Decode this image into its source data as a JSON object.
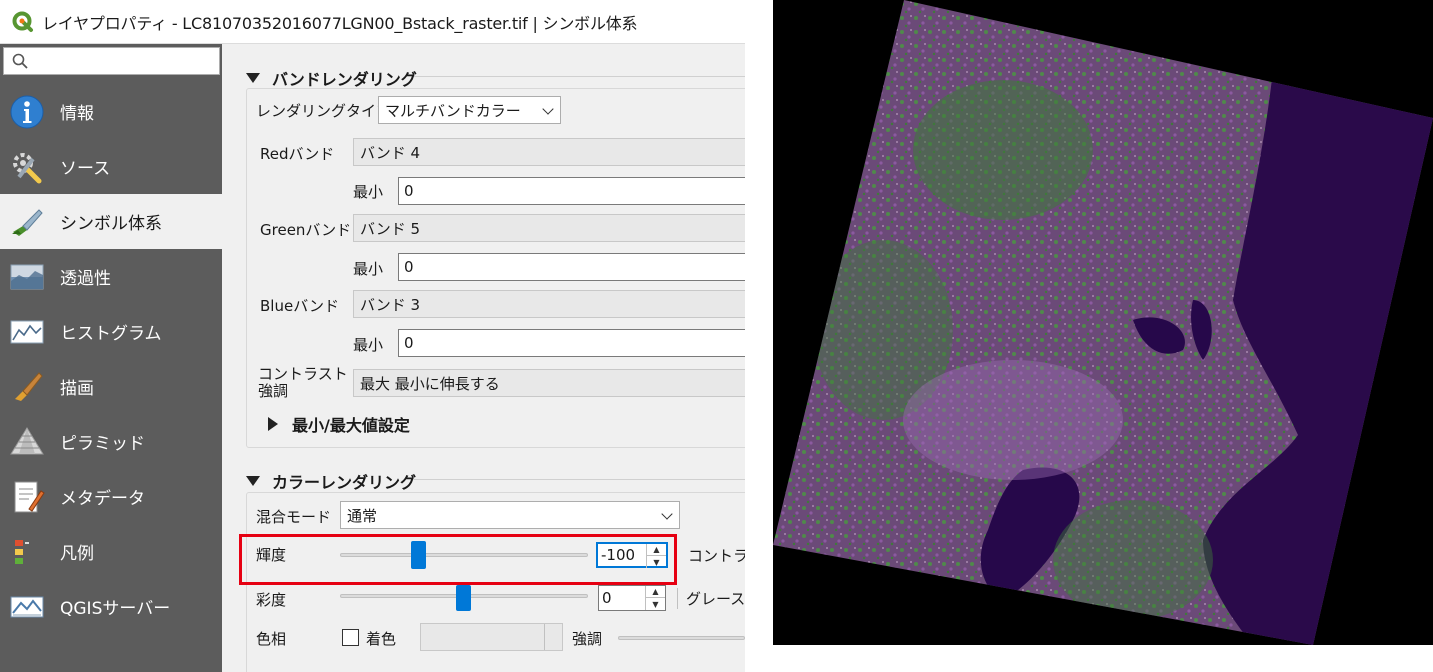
{
  "window": {
    "title": "レイヤプロパティ - LC81070352016077LGN00_Bstack_raster.tif | シンボル体系"
  },
  "sidebar": {
    "search_placeholder": "",
    "items": [
      {
        "label": "情報",
        "icon": "info-icon"
      },
      {
        "label": "ソース",
        "icon": "source-wrench-icon"
      },
      {
        "label": "シンボル体系",
        "icon": "symbology-brush-icon",
        "active": true
      },
      {
        "label": "透過性",
        "icon": "transparency-icon"
      },
      {
        "label": "ヒストグラム",
        "icon": "histogram-icon"
      },
      {
        "label": "描画",
        "icon": "rendering-brush-icon"
      },
      {
        "label": "ピラミッド",
        "icon": "pyramid-icon"
      },
      {
        "label": "メタデータ",
        "icon": "metadata-icon"
      },
      {
        "label": "凡例",
        "icon": "legend-icon"
      },
      {
        "label": "QGISサーバー",
        "icon": "qgis-server-icon"
      }
    ]
  },
  "band_rendering": {
    "header": "バンドレンダリング",
    "render_type_label": "レンダリングタイプ",
    "render_type_value": "マルチバンドカラー",
    "red_label": "Redバンド",
    "red_value": "バンド 4",
    "green_label": "Greenバンド",
    "green_value": "バンド 5",
    "blue_label": "Blueバンド",
    "blue_value": "バンド 3",
    "min_label": "最小",
    "red_min": "0",
    "green_min": "0",
    "blue_min": "0",
    "contrast_label_1": "コントラスト",
    "contrast_label_2": "強調",
    "contrast_value": "最大 最小に伸長する",
    "minmax_header": "最小/最大値設定"
  },
  "color_rendering": {
    "header": "カラーレンダリング",
    "blend_label": "混合モード",
    "blend_value": "通常",
    "brightness_label": "輝度",
    "brightness_value": "-100",
    "brightness_level": -100,
    "contrast_label": "コントラスト",
    "saturation_label": "彩度",
    "saturation_value": "0",
    "grayscale_label": "グレース",
    "hue_label": "色相",
    "colorize_label": "着色",
    "strength_label": "強調"
  },
  "colors": {
    "accent": "#0078d7",
    "highlight": "#e60012",
    "sidebar_bg": "#5c5c5c"
  }
}
